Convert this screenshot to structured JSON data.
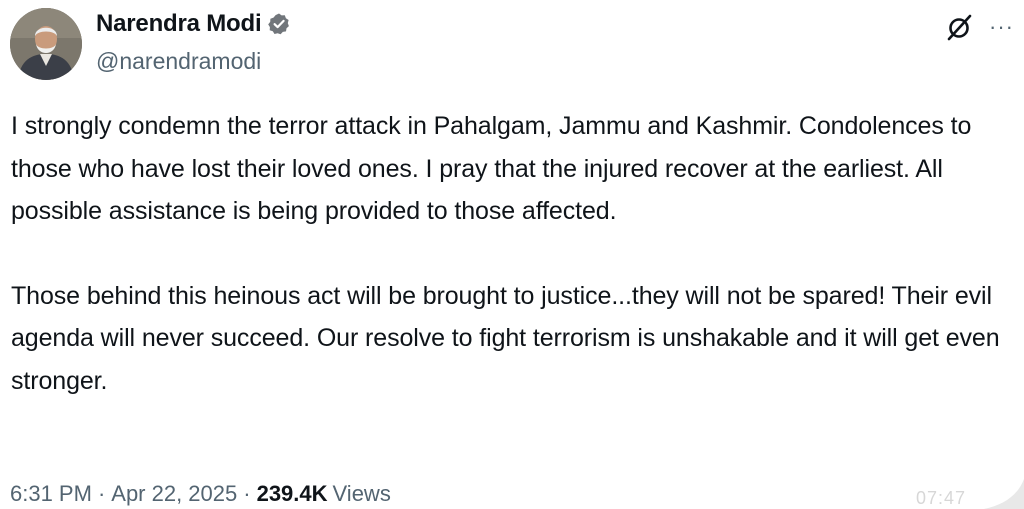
{
  "author": {
    "display_name": "Narendra Modi",
    "handle": "@narendramodi",
    "verified": true,
    "verified_color": "#71767b"
  },
  "actions": {
    "grok_icon": "grok-icon",
    "more_icon": "more-icon",
    "more_label": "···"
  },
  "post": {
    "paragraphs": [
      "I strongly condemn the terror attack in Pahalgam, Jammu and Kashmir. Condolences to those who have lost their loved ones. I pray that the injured recover at the earliest. All possible assistance is being provided to those affected.",
      "Those behind this heinous act will be brought to justice...they will not be spared! Their evil agenda will never succeed. Our resolve to fight terrorism is unshakable and it will get even stronger."
    ]
  },
  "meta": {
    "time": "6:31 PM",
    "separator": "·",
    "date": "Apr 22, 2025",
    "views_count": "239.4K",
    "views_label": "Views"
  },
  "watermark": {
    "text": "07:47"
  }
}
